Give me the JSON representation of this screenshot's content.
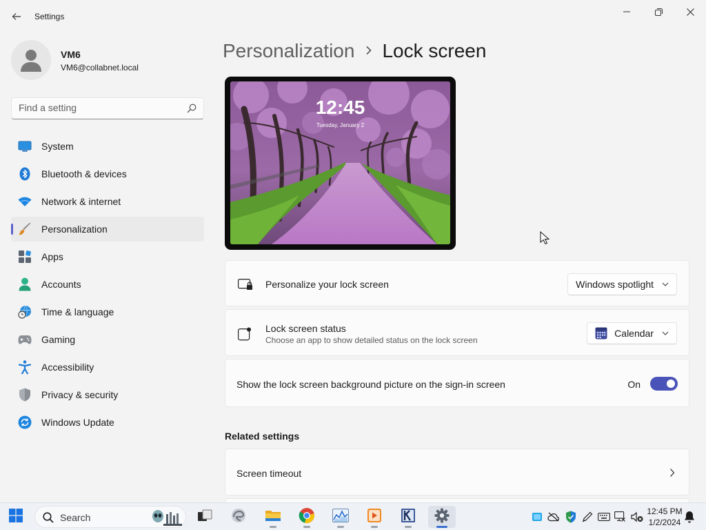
{
  "window": {
    "title": "Settings"
  },
  "user": {
    "name": "VM6",
    "email": "VM6@collabnet.local"
  },
  "search": {
    "placeholder": "Find a setting"
  },
  "nav": [
    {
      "label": "System",
      "icon": "monitor-icon"
    },
    {
      "label": "Bluetooth & devices",
      "icon": "bluetooth-icon"
    },
    {
      "label": "Network & internet",
      "icon": "wifi-icon"
    },
    {
      "label": "Personalization",
      "icon": "brush-icon",
      "active": true
    },
    {
      "label": "Apps",
      "icon": "apps-icon"
    },
    {
      "label": "Accounts",
      "icon": "person-icon"
    },
    {
      "label": "Time & language",
      "icon": "globe-clock-icon"
    },
    {
      "label": "Gaming",
      "icon": "gamepad-icon"
    },
    {
      "label": "Accessibility",
      "icon": "accessibility-icon"
    },
    {
      "label": "Privacy & security",
      "icon": "shield-icon"
    },
    {
      "label": "Windows Update",
      "icon": "update-icon"
    }
  ],
  "breadcrumb": {
    "parent": "Personalization",
    "separator": "›",
    "current": "Lock screen"
  },
  "preview": {
    "time": "12:45",
    "date": "Tuesday, January 2"
  },
  "settings": {
    "personalize": {
      "title": "Personalize your lock screen",
      "value": "Windows spotlight"
    },
    "status": {
      "title": "Lock screen status",
      "subtitle": "Choose an app to show detailed status on the lock screen",
      "value": "Calendar"
    },
    "signin_bg": {
      "title": "Show the lock screen background picture on the sign-in screen",
      "state": "On"
    }
  },
  "related": {
    "heading": "Related settings",
    "items": [
      {
        "label": "Screen timeout"
      }
    ]
  },
  "taskbar": {
    "search_label": "Search",
    "time": "12:45 PM",
    "date": "1/2/2024"
  },
  "colors": {
    "accent": "#4a54b8",
    "background": "#f3f3f3",
    "card": "#fbfbfb"
  }
}
